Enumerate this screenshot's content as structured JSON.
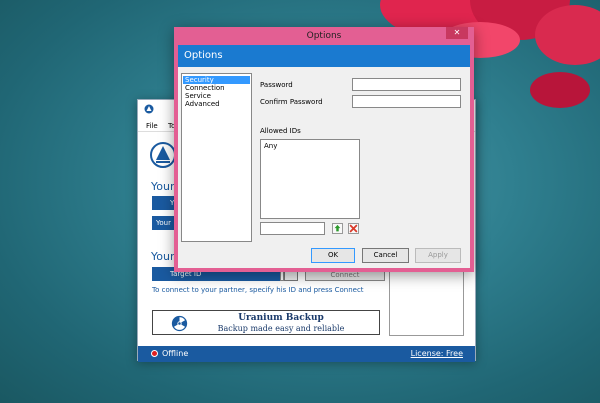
{
  "colors": {
    "accent": "#1a7ad0",
    "app_blue": "#1a5aa0",
    "dialog_frame": "#e35f93",
    "offline": "#e02020",
    "desktop": "#2f7f8f"
  },
  "app": {
    "menu": {
      "file": "File",
      "tools": "To"
    },
    "your_id_heading": "Your",
    "your_id_button": "Y",
    "your_password_button": "Your",
    "partner_heading": "Your",
    "partner_id_label": "Target ID",
    "connect_label": "Connect",
    "hint": "To connect to your partner, specify his ID and press Connect",
    "banner": {
      "title": "Uranium Backup",
      "subtitle": "Backup made easy and reliable"
    },
    "status": "Offline",
    "license": "License: Free"
  },
  "dialog": {
    "window_title": "Options",
    "close_glyph": "✕",
    "header_title": "Options",
    "categories": [
      {
        "label": "Security",
        "selected": true
      },
      {
        "label": "Connection",
        "selected": false
      },
      {
        "label": "Service",
        "selected": false
      },
      {
        "label": "Advanced",
        "selected": false
      }
    ],
    "password_label": "Password",
    "password_value": "",
    "confirm_label": "Confirm Password",
    "confirm_value": "",
    "allowed_ids_label": "Allowed IDs",
    "allowed_ids": [
      "Any"
    ],
    "new_id_value": "",
    "add_icon": "plus-icon",
    "remove_icon": "x-icon",
    "ok_label": "OK",
    "cancel_label": "Cancel",
    "apply_label": "Apply"
  }
}
